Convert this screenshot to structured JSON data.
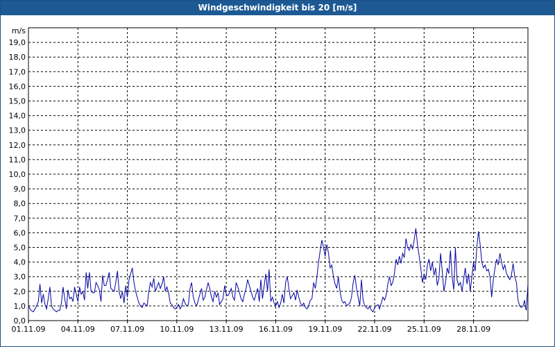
{
  "window": {
    "title": "Windgeschwindigkeit bis 20 [m/s]"
  },
  "chart_data": {
    "type": "line",
    "title": "Windgeschwindigkeit bis 20 [m/s]",
    "ylabel": "m/s",
    "xlabel": "",
    "ylim": [
      0,
      20
    ],
    "xlim": [
      0,
      30.3
    ],
    "grid": true,
    "y_ticks": [
      "0,0",
      "1,0",
      "2,0",
      "3,0",
      "4,0",
      "5,0",
      "6,0",
      "7,0",
      "8,0",
      "9,0",
      "10,0",
      "11,0",
      "12,0",
      "13,0",
      "14,0",
      "15,0",
      "16,0",
      "17,0",
      "18,0",
      "19,0"
    ],
    "x_ticks": [
      {
        "day": 0,
        "label": "01.11.09"
      },
      {
        "day": 3,
        "label": "04.11.09"
      },
      {
        "day": 6,
        "label": "07.11.09"
      },
      {
        "day": 9,
        "label": "10.11.09"
      },
      {
        "day": 12,
        "label": "13.11.09"
      },
      {
        "day": 15,
        "label": "16.11.09"
      },
      {
        "day": 18,
        "label": "19.11.09"
      },
      {
        "day": 21,
        "label": "22.11.09"
      },
      {
        "day": 24,
        "label": "25.11.09"
      },
      {
        "day": 27,
        "label": "28.11.09"
      }
    ],
    "series": [
      {
        "color": "#0000a0",
        "points": [
          [
            0.0,
            1.0
          ],
          [
            0.15,
            0.7
          ],
          [
            0.3,
            0.6
          ],
          [
            0.45,
            0.9
          ],
          [
            0.6,
            1.3
          ],
          [
            0.7,
            2.5
          ],
          [
            0.8,
            1.2
          ],
          [
            0.9,
            1.8
          ],
          [
            1.0,
            1.1
          ],
          [
            1.1,
            0.8
          ],
          [
            1.2,
            1.5
          ],
          [
            1.3,
            2.3
          ],
          [
            1.4,
            1.0
          ],
          [
            1.5,
            0.8
          ],
          [
            1.6,
            0.7
          ],
          [
            1.7,
            0.6
          ],
          [
            1.8,
            0.7
          ],
          [
            1.9,
            0.7
          ],
          [
            2.0,
            1.2
          ],
          [
            2.1,
            2.3
          ],
          [
            2.2,
            1.5
          ],
          [
            2.3,
            0.8
          ],
          [
            2.4,
            2.1
          ],
          [
            2.5,
            1.5
          ],
          [
            2.6,
            1.6
          ],
          [
            2.7,
            1.3
          ],
          [
            2.8,
            2.3
          ],
          [
            2.9,
            1.8
          ],
          [
            3.0,
            1.3
          ],
          [
            3.1,
            2.3
          ],
          [
            3.2,
            1.8
          ],
          [
            3.3,
            2.0
          ],
          [
            3.4,
            1.4
          ],
          [
            3.5,
            3.3
          ],
          [
            3.6,
            2.2
          ],
          [
            3.7,
            3.3
          ],
          [
            3.8,
            2.0
          ],
          [
            3.9,
            1.9
          ],
          [
            4.0,
            1.9
          ],
          [
            4.1,
            2.6
          ],
          [
            4.2,
            2.4
          ],
          [
            4.3,
            2.1
          ],
          [
            4.4,
            1.3
          ],
          [
            4.5,
            3.1
          ],
          [
            4.6,
            2.4
          ],
          [
            4.7,
            2.4
          ],
          [
            4.8,
            2.8
          ],
          [
            4.9,
            3.3
          ],
          [
            5.0,
            2.2
          ],
          [
            5.1,
            2.1
          ],
          [
            5.2,
            2.0
          ],
          [
            5.3,
            2.6
          ],
          [
            5.4,
            3.4
          ],
          [
            5.5,
            2.0
          ],
          [
            5.6,
            1.5
          ],
          [
            5.7,
            2.0
          ],
          [
            5.8,
            1.2
          ],
          [
            5.9,
            2.4
          ],
          [
            6.0,
            1.6
          ],
          [
            6.1,
            2.8
          ],
          [
            6.2,
            3.2
          ],
          [
            6.3,
            3.6
          ],
          [
            6.4,
            2.6
          ],
          [
            6.5,
            2.0
          ],
          [
            6.6,
            1.6
          ],
          [
            6.7,
            1.2
          ],
          [
            6.8,
            1.0
          ],
          [
            6.9,
            0.9
          ],
          [
            7.0,
            1.2
          ],
          [
            7.1,
            1.1
          ],
          [
            7.2,
            1.0
          ],
          [
            7.3,
            2.0
          ],
          [
            7.4,
            2.6
          ],
          [
            7.5,
            2.3
          ],
          [
            7.6,
            2.9
          ],
          [
            7.7,
            2.0
          ],
          [
            7.8,
            2.3
          ],
          [
            7.9,
            2.6
          ],
          [
            8.0,
            2.2
          ],
          [
            8.1,
            2.5
          ],
          [
            8.2,
            3.0
          ],
          [
            8.3,
            2.0
          ],
          [
            8.4,
            2.3
          ],
          [
            8.5,
            1.9
          ],
          [
            8.6,
            1.2
          ],
          [
            8.7,
            1.1
          ],
          [
            8.8,
            0.9
          ],
          [
            8.9,
            0.8
          ],
          [
            9.0,
            0.9
          ],
          [
            9.1,
            1.1
          ],
          [
            9.2,
            0.8
          ],
          [
            9.3,
            1.0
          ],
          [
            9.4,
            1.5
          ],
          [
            9.5,
            1.2
          ],
          [
            9.6,
            1.0
          ],
          [
            9.7,
            1.1
          ],
          [
            9.8,
            2.2
          ],
          [
            9.9,
            2.6
          ],
          [
            10.0,
            1.6
          ],
          [
            10.1,
            1.2
          ],
          [
            10.2,
            1.0
          ],
          [
            10.3,
            1.4
          ],
          [
            10.4,
            1.8
          ],
          [
            10.5,
            2.2
          ],
          [
            10.6,
            1.4
          ],
          [
            10.7,
            1.6
          ],
          [
            10.8,
            2.1
          ],
          [
            10.9,
            2.6
          ],
          [
            11.0,
            2.2
          ],
          [
            11.1,
            1.6
          ],
          [
            11.2,
            1.3
          ],
          [
            11.3,
            2.0
          ],
          [
            11.4,
            1.6
          ],
          [
            11.5,
            1.9
          ],
          [
            11.6,
            1.1
          ],
          [
            11.7,
            1.3
          ],
          [
            11.8,
            1.5
          ],
          [
            11.9,
            2.4
          ],
          [
            12.0,
            1.8
          ],
          [
            12.1,
            1.7
          ],
          [
            12.2,
            1.9
          ],
          [
            12.3,
            2.2
          ],
          [
            12.4,
            1.6
          ],
          [
            12.5,
            1.4
          ],
          [
            12.6,
            2.6
          ],
          [
            12.7,
            2.3
          ],
          [
            12.8,
            1.9
          ],
          [
            12.9,
            1.5
          ],
          [
            13.0,
            1.3
          ],
          [
            13.1,
            1.8
          ],
          [
            13.2,
            2.2
          ],
          [
            13.3,
            2.8
          ],
          [
            13.4,
            2.4
          ],
          [
            13.5,
            2.0
          ],
          [
            13.6,
            1.6
          ],
          [
            13.7,
            1.4
          ],
          [
            13.8,
            1.8
          ],
          [
            13.9,
            2.2
          ],
          [
            14.0,
            1.3
          ],
          [
            14.1,
            2.8
          ],
          [
            14.2,
            1.5
          ],
          [
            14.3,
            2.4
          ],
          [
            14.4,
            3.2
          ],
          [
            14.5,
            2.0
          ],
          [
            14.6,
            3.5
          ],
          [
            14.7,
            1.3
          ],
          [
            14.8,
            1.6
          ],
          [
            14.9,
            1.2
          ],
          [
            15.0,
            1.0
          ],
          [
            15.1,
            1.3
          ],
          [
            15.2,
            0.9
          ],
          [
            15.3,
            1.2
          ],
          [
            15.4,
            1.8
          ],
          [
            15.5,
            1.2
          ],
          [
            15.6,
            2.6
          ],
          [
            15.7,
            3.0
          ],
          [
            15.8,
            2.2
          ],
          [
            15.9,
            1.5
          ],
          [
            16.0,
            1.7
          ],
          [
            16.1,
            1.9
          ],
          [
            16.2,
            1.4
          ],
          [
            16.3,
            2.1
          ],
          [
            16.4,
            1.6
          ],
          [
            16.5,
            1.2
          ],
          [
            16.6,
            1.0
          ],
          [
            16.7,
            1.2
          ],
          [
            16.8,
            0.9
          ],
          [
            16.9,
            0.8
          ],
          [
            17.0,
            1.0
          ],
          [
            17.1,
            1.4
          ],
          [
            17.2,
            1.5
          ],
          [
            17.3,
            2.6
          ],
          [
            17.4,
            2.2
          ],
          [
            17.5,
            3.0
          ],
          [
            17.6,
            4.0
          ],
          [
            17.7,
            4.8
          ],
          [
            17.8,
            5.5
          ],
          [
            17.9,
            5.0
          ],
          [
            18.0,
            4.4
          ],
          [
            18.1,
            5.2
          ],
          [
            18.2,
            4.6
          ],
          [
            18.3,
            3.6
          ],
          [
            18.4,
            3.8
          ],
          [
            18.5,
            3.0
          ],
          [
            18.6,
            2.5
          ],
          [
            18.7,
            2.2
          ],
          [
            18.8,
            3.0
          ],
          [
            18.9,
            2.0
          ],
          [
            19.0,
            1.4
          ],
          [
            19.1,
            1.2
          ],
          [
            19.2,
            1.3
          ],
          [
            19.3,
            1.0
          ],
          [
            19.4,
            1.1
          ],
          [
            19.5,
            1.2
          ],
          [
            19.6,
            1.6
          ],
          [
            19.7,
            2.6
          ],
          [
            19.8,
            3.1
          ],
          [
            19.9,
            2.2
          ],
          [
            20.0,
            1.6
          ],
          [
            20.1,
            1.0
          ],
          [
            20.2,
            2.8
          ],
          [
            20.3,
            1.4
          ],
          [
            20.4,
            1.0
          ],
          [
            20.5,
            0.9
          ],
          [
            20.6,
            0.8
          ],
          [
            20.7,
            1.0
          ],
          [
            20.8,
            0.7
          ],
          [
            20.9,
            0.6
          ],
          [
            21.0,
            0.9
          ],
          [
            21.1,
            1.0
          ],
          [
            21.2,
            1.1
          ],
          [
            21.3,
            0.8
          ],
          [
            21.4,
            1.2
          ],
          [
            21.5,
            1.6
          ],
          [
            21.6,
            1.4
          ],
          [
            21.7,
            1.7
          ],
          [
            21.8,
            2.5
          ],
          [
            21.9,
            3.0
          ],
          [
            22.0,
            2.4
          ],
          [
            22.1,
            2.6
          ],
          [
            22.2,
            3.2
          ],
          [
            22.3,
            4.2
          ],
          [
            22.4,
            3.8
          ],
          [
            22.5,
            4.4
          ],
          [
            22.6,
            3.9
          ],
          [
            22.7,
            4.6
          ],
          [
            22.8,
            4.3
          ],
          [
            22.9,
            5.6
          ],
          [
            23.0,
            5.0
          ],
          [
            23.1,
            4.8
          ],
          [
            23.2,
            5.2
          ],
          [
            23.3,
            4.9
          ],
          [
            23.4,
            5.5
          ],
          [
            23.5,
            6.3
          ],
          [
            23.6,
            5.2
          ],
          [
            23.7,
            4.4
          ],
          [
            23.8,
            3.6
          ],
          [
            23.9,
            2.6
          ],
          [
            24.0,
            3.2
          ],
          [
            24.1,
            2.8
          ],
          [
            24.2,
            3.8
          ],
          [
            24.3,
            4.2
          ],
          [
            24.4,
            3.4
          ],
          [
            24.5,
            4.0
          ],
          [
            24.6,
            3.1
          ],
          [
            24.7,
            3.6
          ],
          [
            24.8,
            2.4
          ],
          [
            24.9,
            2.9
          ],
          [
            25.0,
            4.6
          ],
          [
            25.1,
            3.4
          ],
          [
            25.2,
            2.0
          ],
          [
            25.3,
            2.6
          ],
          [
            25.4,
            3.6
          ],
          [
            25.5,
            3.2
          ],
          [
            25.6,
            4.8
          ],
          [
            25.7,
            3.0
          ],
          [
            25.8,
            2.1
          ],
          [
            25.9,
            5.0
          ],
          [
            26.0,
            2.8
          ],
          [
            26.1,
            2.4
          ],
          [
            26.2,
            2.6
          ],
          [
            26.3,
            2.0
          ],
          [
            26.4,
            2.8
          ],
          [
            26.5,
            3.6
          ],
          [
            26.6,
            2.5
          ],
          [
            26.7,
            3.2
          ],
          [
            26.8,
            2.0
          ],
          [
            26.9,
            3.0
          ],
          [
            27.0,
            4.0
          ],
          [
            27.1,
            3.4
          ],
          [
            27.2,
            5.0
          ],
          [
            27.3,
            6.1
          ],
          [
            27.4,
            5.2
          ],
          [
            27.5,
            4.0
          ],
          [
            27.6,
            3.6
          ],
          [
            27.7,
            3.8
          ],
          [
            27.8,
            3.4
          ],
          [
            27.9,
            3.5
          ],
          [
            28.0,
            3.0
          ],
          [
            28.1,
            1.6
          ],
          [
            28.2,
            2.8
          ],
          [
            28.3,
            3.6
          ],
          [
            28.4,
            4.2
          ],
          [
            28.5,
            3.8
          ],
          [
            28.6,
            4.6
          ],
          [
            28.7,
            4.0
          ],
          [
            28.8,
            3.5
          ],
          [
            28.9,
            3.8
          ],
          [
            29.0,
            3.2
          ],
          [
            29.1,
            3.0
          ],
          [
            29.2,
            2.8
          ],
          [
            29.3,
            3.1
          ],
          [
            29.4,
            3.9
          ],
          [
            29.5,
            3.0
          ],
          [
            29.6,
            2.6
          ],
          [
            29.7,
            1.4
          ],
          [
            29.8,
            1.0
          ],
          [
            29.9,
            0.9
          ],
          [
            30.0,
            1.0
          ],
          [
            30.1,
            1.4
          ],
          [
            30.15,
            0.9
          ],
          [
            30.2,
            0.7
          ],
          [
            30.25,
            1.6
          ],
          [
            30.3,
            2.5
          ]
        ]
      }
    ]
  }
}
